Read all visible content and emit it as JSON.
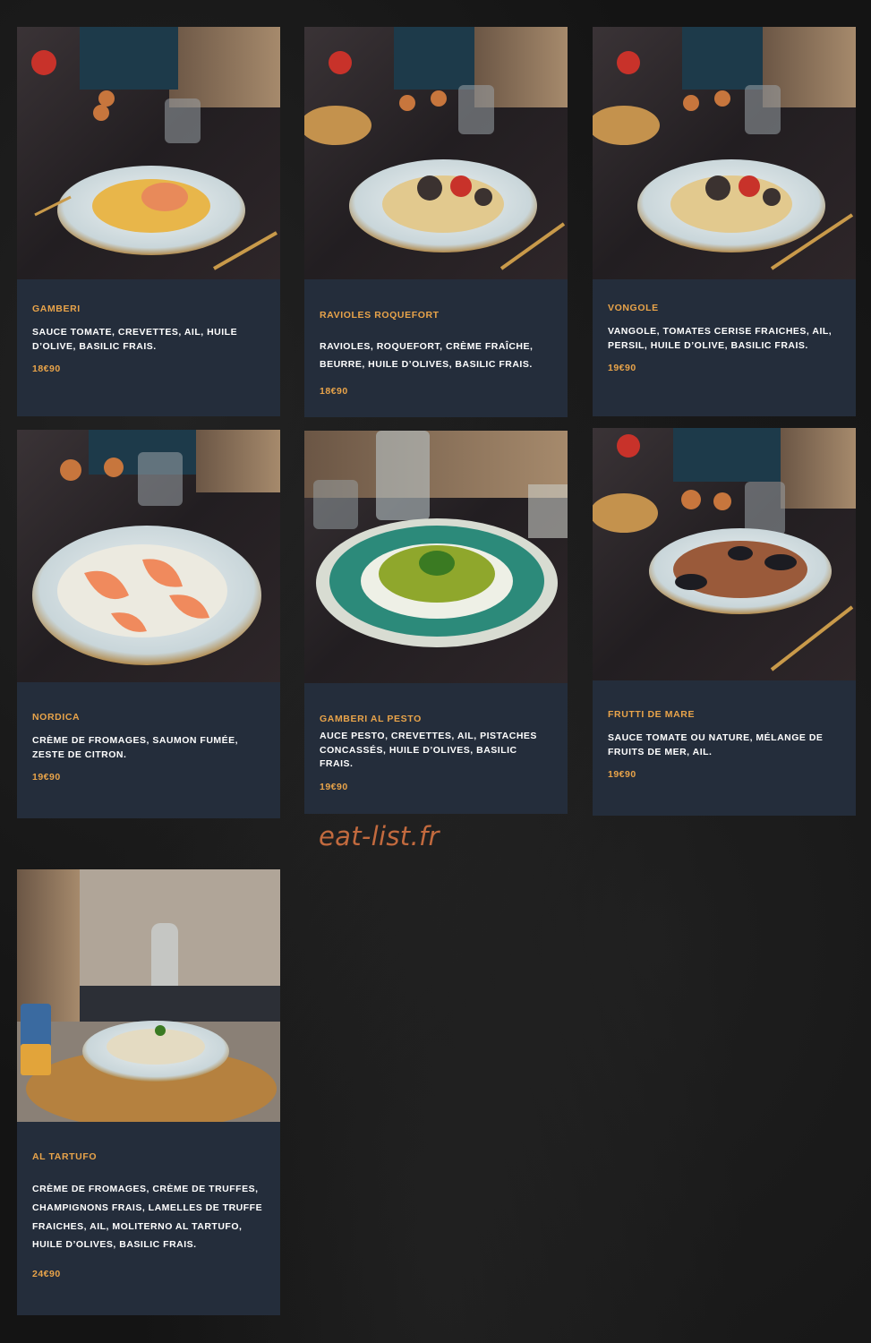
{
  "watermark": "eat-list.fr",
  "colors": {
    "card_bg": "#242d3b",
    "accent": "#e9a44a",
    "text": "#ffffff",
    "page_bg": "#141414"
  },
  "dishes": [
    {
      "name": "GAMBERI",
      "description": "SAUCE TOMATE, CREVETTES, AIL, HUILE D’OLIVE, BASILIC FRAIS.",
      "price": "18€90",
      "photo": "penne-shrimp-photo"
    },
    {
      "name": "RAVIOLES ROQUEFORT",
      "description": "RAVIOLES, ROQUEFORT, CRÈME FRAÎCHE, BEURRE, HUILE D’OLIVES, BASILIC FRAIS.",
      "price": "18€90",
      "photo": "spaghetti-clams-photo"
    },
    {
      "name": "VONGOLE",
      "description": "VANGOLE, TOMATES CERISE FRAICHES, AIL, PERSIL, HUILE D’OLIVE, BASILIC FRAIS.",
      "price": "19€90",
      "photo": "spaghetti-clams-photo"
    },
    {
      "name": "NORDICA",
      "description": "CRÈME DE FROMAGES, SAUMON FUMÉE, ZESTE DE CITRON.",
      "price": "19€90",
      "photo": "salmon-cream-photo"
    },
    {
      "name": "GAMBERI AL PESTO",
      "description": "AUCE PESTO, CREVETTES, AIL, PISTACHES CONCASSÉS, HUILE D’OLIVES, BASILIC FRAIS.",
      "price": "19€90",
      "photo": "pesto-pasta-photo"
    },
    {
      "name": "FRUTTI DE MARE",
      "description": "SAUCE TOMATE OU NATURE, MÉLANGE DE FRUITS DE MER, AIL.",
      "price": "19€90",
      "photo": "seafood-pasta-photo"
    },
    {
      "name": "AL TARTUFO",
      "description": "CRÈME DE FROMAGES, CRÈME DE TRUFFES, CHAMPIGNONS FRAIS, LAMELLES DE TRUFFE FRAICHES, AIL, MOLITERNO AL TARTUFO, HUILE D’OLIVES, BASILIC FRAIS.",
      "price": "24€90",
      "photo": "truffle-pasta-photo"
    }
  ]
}
